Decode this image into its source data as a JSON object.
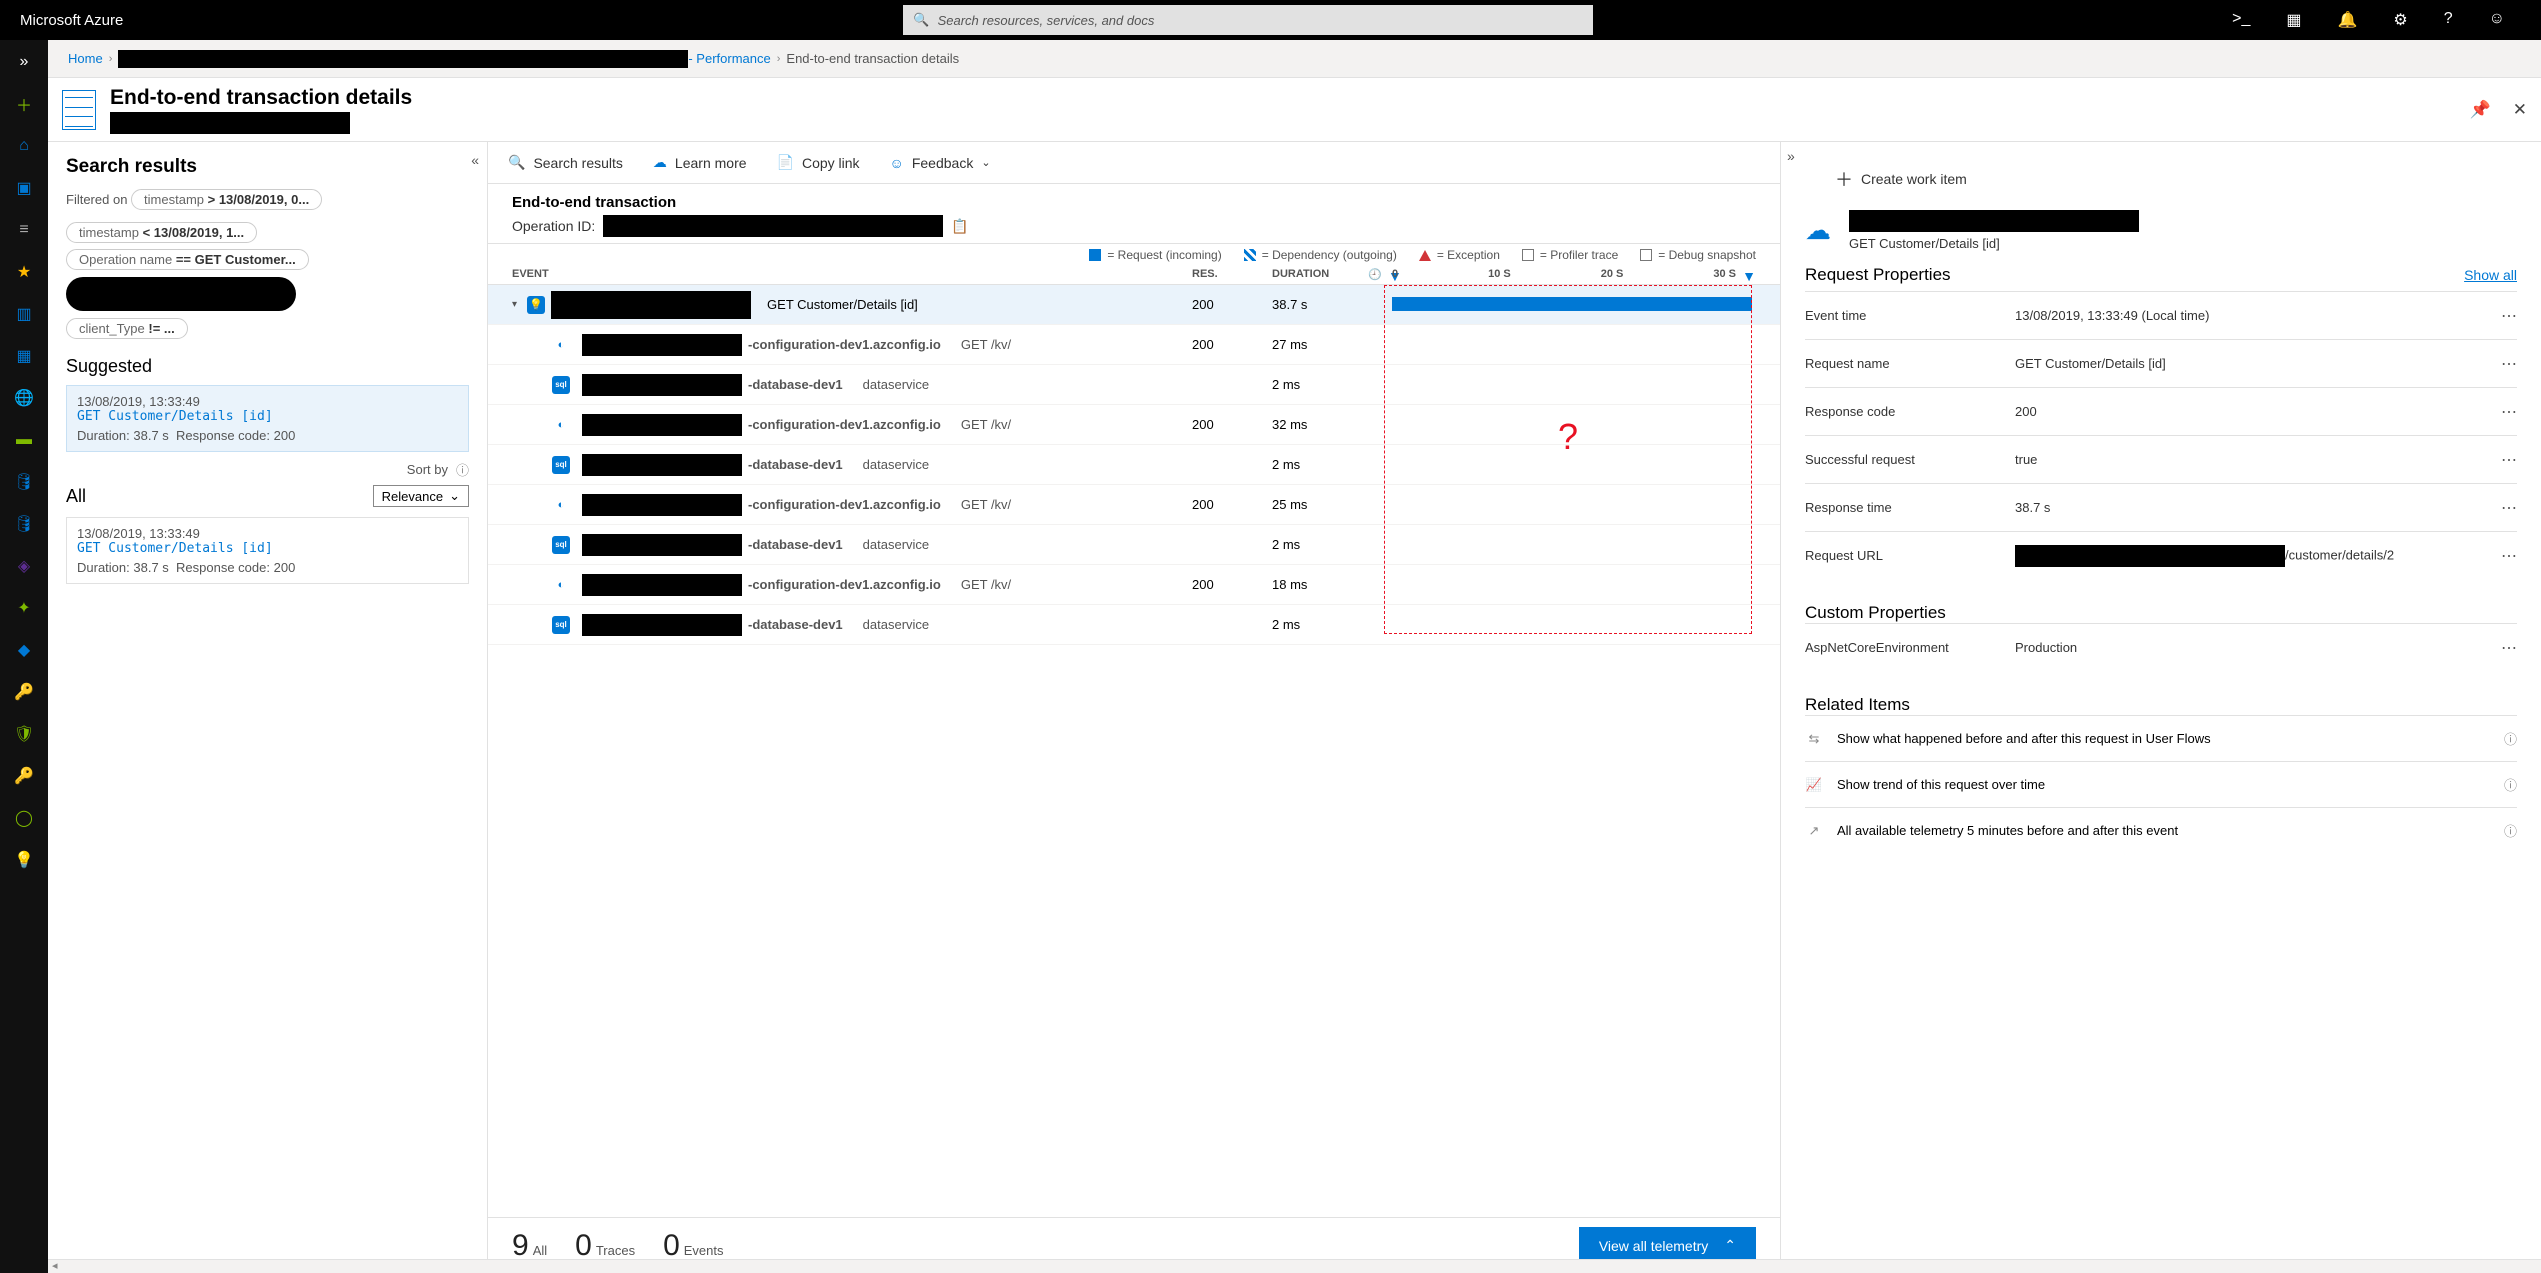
{
  "topbar": {
    "brand": "Microsoft Azure",
    "search_placeholder": "Search resources, services, and docs"
  },
  "breadcrumb": {
    "home": "Home",
    "perf": " - Performance",
    "current": "End-to-end transaction details"
  },
  "page": {
    "title": "End-to-end transaction details"
  },
  "results": {
    "title": "Search results",
    "filtered_on_label": "Filtered on",
    "filters": [
      "timestamp > 13/08/2019, 0...",
      "timestamp < 13/08/2019, 1...",
      "Operation name == GET Customer...",
      "client_Type != ..."
    ],
    "suggested_label": "Suggested",
    "all_label": "All",
    "sort_label": "Sort by",
    "sort_value": "Relevance",
    "card": {
      "ts": "13/08/2019, 13:33:49",
      "op": "GET Customer/Details [id]",
      "dur_label": "Duration:",
      "dur": "38.7 s",
      "resp_label": "Response code:",
      "resp": "200"
    }
  },
  "toolbar": {
    "search": "Search results",
    "learn": "Learn more",
    "copy": "Copy link",
    "feedback": "Feedback"
  },
  "trans": {
    "title": "End-to-end transaction",
    "opid_label": "Operation ID:",
    "legend": {
      "req": "= Request (incoming)",
      "dep": "= Dependency (outgoing)",
      "exc": "= Exception",
      "prof": "= Profiler trace",
      "debug": "= Debug snapshot"
    },
    "cols": {
      "event": "EVENT",
      "res": "RES.",
      "dur": "DURATION"
    },
    "scale": [
      "0",
      "10 S",
      "20 S",
      "30 S"
    ],
    "main_row": {
      "name": "GET Customer/Details [id]",
      "res": "200",
      "dur": "38.7 s"
    },
    "rows": [
      {
        "icon": "azure",
        "host": "-configuration-dev1.azconfig.io",
        "path": "GET /kv/",
        "res": "200",
        "dur": "27 ms"
      },
      {
        "icon": "sql",
        "host": "-database-dev1",
        "path": "dataservice",
        "res": "",
        "dur": "2 ms"
      },
      {
        "icon": "azure",
        "host": "-configuration-dev1.azconfig.io",
        "path": "GET /kv/",
        "res": "200",
        "dur": "32 ms"
      },
      {
        "icon": "sql",
        "host": "-database-dev1",
        "path": "dataservice",
        "res": "",
        "dur": "2 ms"
      },
      {
        "icon": "azure",
        "host": "-configuration-dev1.azconfig.io",
        "path": "GET /kv/",
        "res": "200",
        "dur": "25 ms"
      },
      {
        "icon": "sql",
        "host": "-database-dev1",
        "path": "dataservice",
        "res": "",
        "dur": "2 ms"
      },
      {
        "icon": "azure",
        "host": "-configuration-dev1.azconfig.io",
        "path": "GET /kv/",
        "res": "200",
        "dur": "18 ms"
      },
      {
        "icon": "sql",
        "host": "-database-dev1",
        "path": "dataservice",
        "res": "",
        "dur": "2 ms"
      }
    ]
  },
  "counts": {
    "all": "9",
    "all_lbl": "All",
    "traces": "0",
    "traces_lbl": "Traces",
    "events": "0",
    "events_lbl": "Events",
    "view_all": "View all telemetry"
  },
  "right": {
    "create_work": "Create work item",
    "req_name": "GET Customer/Details [id]",
    "props_title": "Request Properties",
    "show_all": "Show all",
    "rows": [
      {
        "lbl": "Event time",
        "val": "13/08/2019, 13:33:49 (Local time)"
      },
      {
        "lbl": "Request name",
        "val": "GET Customer/Details [id]"
      },
      {
        "lbl": "Response code",
        "val": "200"
      },
      {
        "lbl": "Successful request",
        "val": "true"
      },
      {
        "lbl": "Response time",
        "val": "38.7 s"
      },
      {
        "lbl": "Request URL",
        "val": "/customer/details/2",
        "blackPrefix": true
      }
    ],
    "custom_title": "Custom Properties",
    "custom_rows": [
      {
        "lbl": "AspNetCoreEnvironment",
        "val": "Production"
      }
    ],
    "related_title": "Related Items",
    "related": [
      "Show what happened before and after this request in User Flows",
      "Show trend of this request over time",
      "All available telemetry 5 minutes before and after this event"
    ]
  }
}
